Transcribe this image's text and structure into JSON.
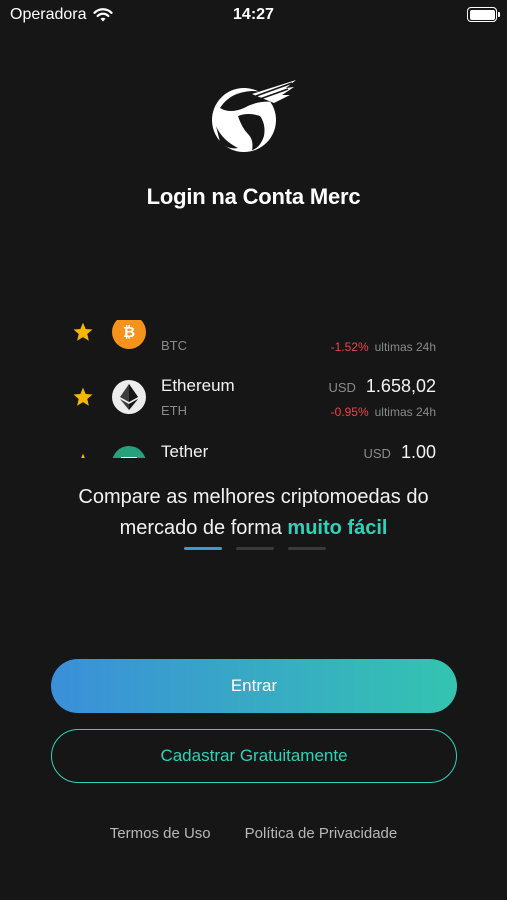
{
  "status_bar": {
    "carrier": "Operadora",
    "time": "14:27"
  },
  "header": {
    "title": "Login na Conta Merc"
  },
  "coins": [
    {
      "name": "",
      "symbol": "BTC",
      "currency": "",
      "price": "",
      "change": "-1.52%",
      "period": "ultimas 24h",
      "icon": "bitcoin-icon",
      "color": "#f7931a"
    },
    {
      "name": "Ethereum",
      "symbol": "ETH",
      "currency": "USD",
      "price": "1.658,02",
      "change": "-0.95%",
      "period": "ultimas 24h",
      "icon": "ethereum-icon",
      "color": "#e8e8e8"
    },
    {
      "name": "Tether",
      "symbol": "",
      "currency": "USD",
      "price": "1,00",
      "change": "",
      "period": "",
      "icon": "tether-icon",
      "color": "#26a17b"
    }
  ],
  "tagline": {
    "line1": "Compare as melhores criptomoedas do",
    "line2_prefix": "mercado de forma ",
    "highlight": "muito fácil"
  },
  "pager": {
    "active_index": 0,
    "count": 3
  },
  "buttons": {
    "login": "Entrar",
    "signup": "Cadastrar Gratuitamente"
  },
  "footer": {
    "terms": "Termos de Uso",
    "privacy": "Política de Privacidade"
  },
  "colors": {
    "accent": "#2fd2b6",
    "gradient_start": "#3b8fd9",
    "gradient_end": "#34c4b0",
    "negative": "#e5484d",
    "star": "#f5b700"
  }
}
